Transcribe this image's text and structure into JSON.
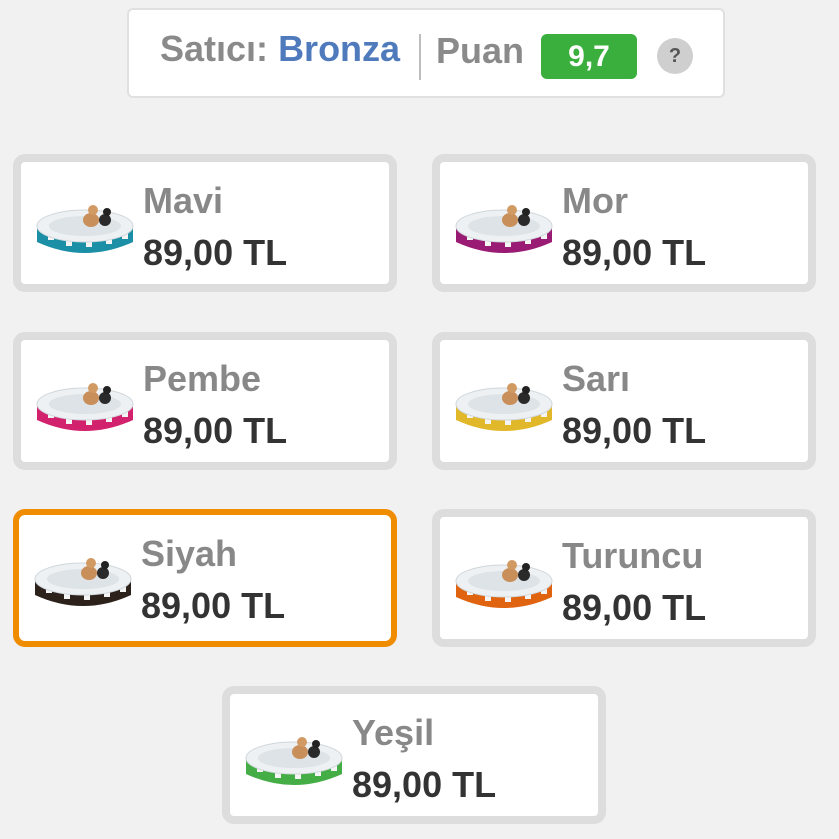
{
  "seller": {
    "label": "Satıcı:",
    "name": "Bronza",
    "score_label": "Puan",
    "score": "9,7",
    "score_color": "#3aaf3d",
    "help_icon": "question-icon",
    "help_text": "?"
  },
  "variants": [
    {
      "name": "Mavi",
      "price": "89,00 TL",
      "color": "#1a8fa5",
      "selected": false
    },
    {
      "name": "Mor",
      "price": "89,00 TL",
      "color": "#9a1b73",
      "selected": false
    },
    {
      "name": "Pembe",
      "price": "89,00 TL",
      "color": "#d3226d",
      "selected": false
    },
    {
      "name": "Sarı",
      "price": "89,00 TL",
      "color": "#e2b82b",
      "selected": false
    },
    {
      "name": "Siyah",
      "price": "89,00 TL",
      "color": "#2c211b",
      "selected": true
    },
    {
      "name": "Turuncu",
      "price": "89,00 TL",
      "color": "#e0630f",
      "selected": false
    },
    {
      "name": "Yeşil",
      "price": "89,00 TL",
      "color": "#45ad46",
      "selected": false
    }
  ],
  "colors": {
    "selected_border": "#f08c00",
    "seller_name": "#4f7bbd"
  }
}
